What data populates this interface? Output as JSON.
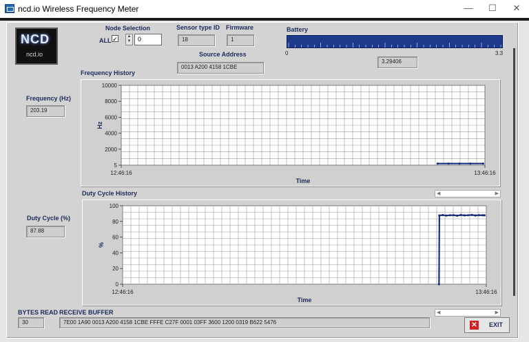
{
  "window": {
    "title": "ncd.io Wireless Frequency Meter",
    "controls": [
      "—",
      "☐",
      "✕"
    ]
  },
  "logo": {
    "text": "NCD",
    "subtext": "ncd.io"
  },
  "node_selection": {
    "label": "Node Selection",
    "all_label": "ALL",
    "all_checked": true,
    "check_glyph": "✓",
    "value": "0"
  },
  "sensor_type": {
    "label": "Sensor type ID",
    "value": "18"
  },
  "firmware": {
    "label": "Firmware",
    "value": "1"
  },
  "source_address": {
    "label": "Source Address",
    "value": "0013 A200 4158 1CBE"
  },
  "battery": {
    "label": "Battery",
    "min": "0",
    "max": "3.3",
    "value": "3.29406",
    "fill_fraction": 0.998
  },
  "frequency": {
    "label": "Frequency (Hz)",
    "value": "203.19"
  },
  "duty_cycle": {
    "label": "Duty Cycle (%)",
    "value": "87.88"
  },
  "bytes_read": {
    "label": "BYTES READ",
    "value": "30"
  },
  "receive_buffer": {
    "label": "RECEIVE BUFFER",
    "value": "7E00 1A90 0013 A200 4158 1CBE FFFE C27F 0001 03FF 3600 1200 0319 B622 5476"
  },
  "exit_button": {
    "label": "EXIT",
    "icon": "close-icon"
  },
  "scrollbar_arrows": {
    "left": "◀",
    "right": "▶"
  },
  "chart_data": [
    {
      "type": "line",
      "title": "Frequency History",
      "xlabel": "Time",
      "ylabel": "Hz",
      "x_tick_labels": [
        "12:46:16",
        "13:46:16"
      ],
      "y_tick_labels": [
        "10000",
        "8000",
        "6000",
        "4000",
        "2000",
        "5"
      ],
      "ylim": [
        5,
        10000
      ],
      "grid": true,
      "color": "#1a2f7a",
      "series": [
        {
          "x": [
            0.87,
            0.9,
            0.93,
            0.96,
            0.995
          ],
          "values": [
            203,
            203,
            203,
            203,
            203
          ]
        }
      ]
    },
    {
      "type": "line",
      "title": "Duty Cycle History",
      "xlabel": "Time",
      "ylabel": "%",
      "x_tick_labels": [
        "12:46:16",
        "13:46:16"
      ],
      "y_tick_labels": [
        "100",
        "80",
        "60",
        "40",
        "20",
        "0"
      ],
      "ylim": [
        0,
        100
      ],
      "grid": true,
      "color": "#1a2f7a",
      "series": [
        {
          "x": [
            0.87,
            0.871,
            0.88,
            0.89,
            0.9,
            0.91,
            0.92,
            0.93,
            0.94,
            0.95,
            0.96,
            0.97,
            0.98,
            0.99,
            0.995
          ],
          "values": [
            0,
            87.6,
            88.1,
            87.5,
            87.9,
            88.0,
            87.4,
            88.2,
            87.7,
            87.9,
            88.3,
            87.6,
            88.0,
            87.8,
            87.88
          ]
        }
      ]
    }
  ]
}
